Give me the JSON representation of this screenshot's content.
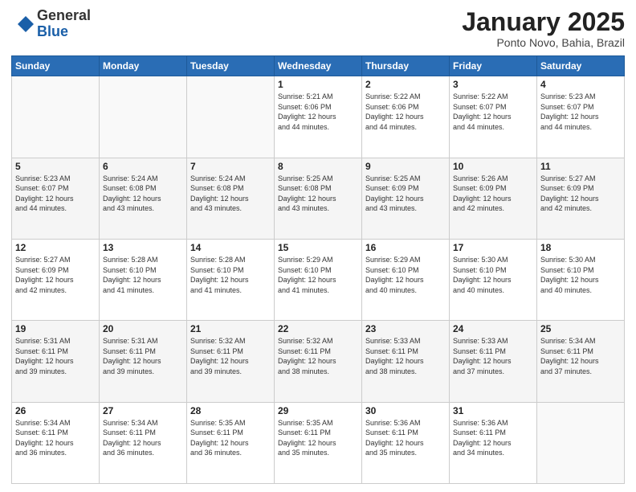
{
  "header": {
    "logo_general": "General",
    "logo_blue": "Blue",
    "month_title": "January 2025",
    "location": "Ponto Novo, Bahia, Brazil"
  },
  "days_of_week": [
    "Sunday",
    "Monday",
    "Tuesday",
    "Wednesday",
    "Thursday",
    "Friday",
    "Saturday"
  ],
  "weeks": [
    [
      {
        "day": "",
        "info": ""
      },
      {
        "day": "",
        "info": ""
      },
      {
        "day": "",
        "info": ""
      },
      {
        "day": "1",
        "info": "Sunrise: 5:21 AM\nSunset: 6:06 PM\nDaylight: 12 hours\nand 44 minutes."
      },
      {
        "day": "2",
        "info": "Sunrise: 5:22 AM\nSunset: 6:06 PM\nDaylight: 12 hours\nand 44 minutes."
      },
      {
        "day": "3",
        "info": "Sunrise: 5:22 AM\nSunset: 6:07 PM\nDaylight: 12 hours\nand 44 minutes."
      },
      {
        "day": "4",
        "info": "Sunrise: 5:23 AM\nSunset: 6:07 PM\nDaylight: 12 hours\nand 44 minutes."
      }
    ],
    [
      {
        "day": "5",
        "info": "Sunrise: 5:23 AM\nSunset: 6:07 PM\nDaylight: 12 hours\nand 44 minutes."
      },
      {
        "day": "6",
        "info": "Sunrise: 5:24 AM\nSunset: 6:08 PM\nDaylight: 12 hours\nand 43 minutes."
      },
      {
        "day": "7",
        "info": "Sunrise: 5:24 AM\nSunset: 6:08 PM\nDaylight: 12 hours\nand 43 minutes."
      },
      {
        "day": "8",
        "info": "Sunrise: 5:25 AM\nSunset: 6:08 PM\nDaylight: 12 hours\nand 43 minutes."
      },
      {
        "day": "9",
        "info": "Sunrise: 5:25 AM\nSunset: 6:09 PM\nDaylight: 12 hours\nand 43 minutes."
      },
      {
        "day": "10",
        "info": "Sunrise: 5:26 AM\nSunset: 6:09 PM\nDaylight: 12 hours\nand 42 minutes."
      },
      {
        "day": "11",
        "info": "Sunrise: 5:27 AM\nSunset: 6:09 PM\nDaylight: 12 hours\nand 42 minutes."
      }
    ],
    [
      {
        "day": "12",
        "info": "Sunrise: 5:27 AM\nSunset: 6:09 PM\nDaylight: 12 hours\nand 42 minutes."
      },
      {
        "day": "13",
        "info": "Sunrise: 5:28 AM\nSunset: 6:10 PM\nDaylight: 12 hours\nand 41 minutes."
      },
      {
        "day": "14",
        "info": "Sunrise: 5:28 AM\nSunset: 6:10 PM\nDaylight: 12 hours\nand 41 minutes."
      },
      {
        "day": "15",
        "info": "Sunrise: 5:29 AM\nSunset: 6:10 PM\nDaylight: 12 hours\nand 41 minutes."
      },
      {
        "day": "16",
        "info": "Sunrise: 5:29 AM\nSunset: 6:10 PM\nDaylight: 12 hours\nand 40 minutes."
      },
      {
        "day": "17",
        "info": "Sunrise: 5:30 AM\nSunset: 6:10 PM\nDaylight: 12 hours\nand 40 minutes."
      },
      {
        "day": "18",
        "info": "Sunrise: 5:30 AM\nSunset: 6:10 PM\nDaylight: 12 hours\nand 40 minutes."
      }
    ],
    [
      {
        "day": "19",
        "info": "Sunrise: 5:31 AM\nSunset: 6:11 PM\nDaylight: 12 hours\nand 39 minutes."
      },
      {
        "day": "20",
        "info": "Sunrise: 5:31 AM\nSunset: 6:11 PM\nDaylight: 12 hours\nand 39 minutes."
      },
      {
        "day": "21",
        "info": "Sunrise: 5:32 AM\nSunset: 6:11 PM\nDaylight: 12 hours\nand 39 minutes."
      },
      {
        "day": "22",
        "info": "Sunrise: 5:32 AM\nSunset: 6:11 PM\nDaylight: 12 hours\nand 38 minutes."
      },
      {
        "day": "23",
        "info": "Sunrise: 5:33 AM\nSunset: 6:11 PM\nDaylight: 12 hours\nand 38 minutes."
      },
      {
        "day": "24",
        "info": "Sunrise: 5:33 AM\nSunset: 6:11 PM\nDaylight: 12 hours\nand 37 minutes."
      },
      {
        "day": "25",
        "info": "Sunrise: 5:34 AM\nSunset: 6:11 PM\nDaylight: 12 hours\nand 37 minutes."
      }
    ],
    [
      {
        "day": "26",
        "info": "Sunrise: 5:34 AM\nSunset: 6:11 PM\nDaylight: 12 hours\nand 36 minutes."
      },
      {
        "day": "27",
        "info": "Sunrise: 5:34 AM\nSunset: 6:11 PM\nDaylight: 12 hours\nand 36 minutes."
      },
      {
        "day": "28",
        "info": "Sunrise: 5:35 AM\nSunset: 6:11 PM\nDaylight: 12 hours\nand 36 minutes."
      },
      {
        "day": "29",
        "info": "Sunrise: 5:35 AM\nSunset: 6:11 PM\nDaylight: 12 hours\nand 35 minutes."
      },
      {
        "day": "30",
        "info": "Sunrise: 5:36 AM\nSunset: 6:11 PM\nDaylight: 12 hours\nand 35 minutes."
      },
      {
        "day": "31",
        "info": "Sunrise: 5:36 AM\nSunset: 6:11 PM\nDaylight: 12 hours\nand 34 minutes."
      },
      {
        "day": "",
        "info": ""
      }
    ]
  ]
}
